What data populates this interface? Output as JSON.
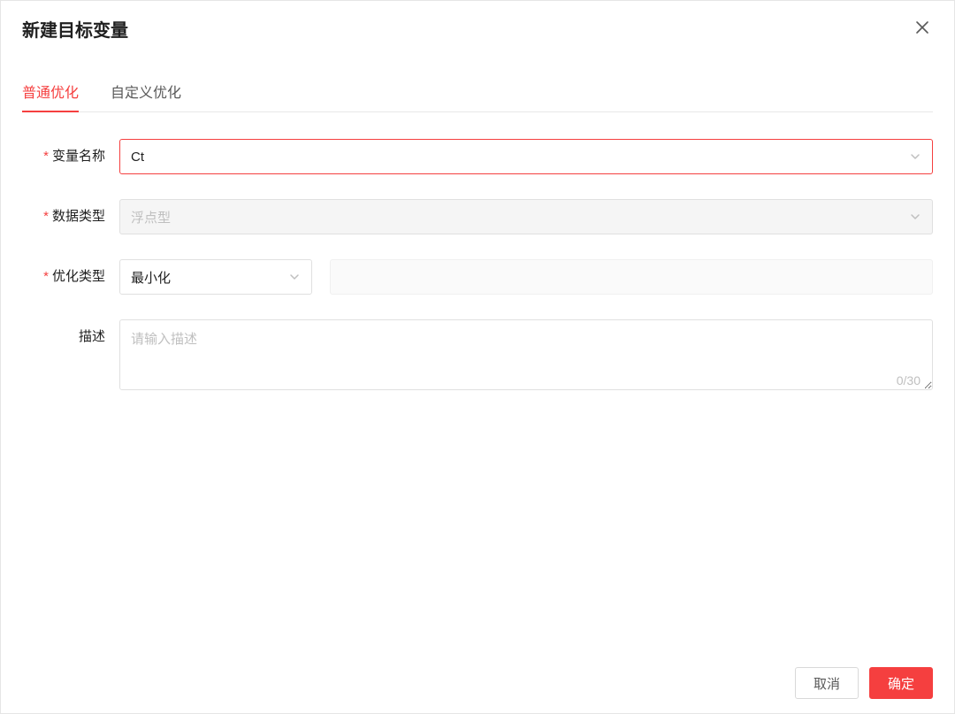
{
  "modal": {
    "title": "新建目标变量"
  },
  "tabs": [
    {
      "label": "普通优化",
      "active": true
    },
    {
      "label": "自定义优化",
      "active": false
    }
  ],
  "form": {
    "varname": {
      "label": "变量名称",
      "value": "Ct",
      "required": true
    },
    "datatype": {
      "label": "数据类型",
      "value": "浮点型",
      "required": true,
      "disabled": true
    },
    "opttype": {
      "label": "优化类型",
      "value": "最小化",
      "required": true
    },
    "desc": {
      "label": "描述",
      "placeholder": "请输入描述",
      "value": "",
      "counter": "0/30"
    }
  },
  "footer": {
    "cancel": "取消",
    "confirm": "确定"
  }
}
